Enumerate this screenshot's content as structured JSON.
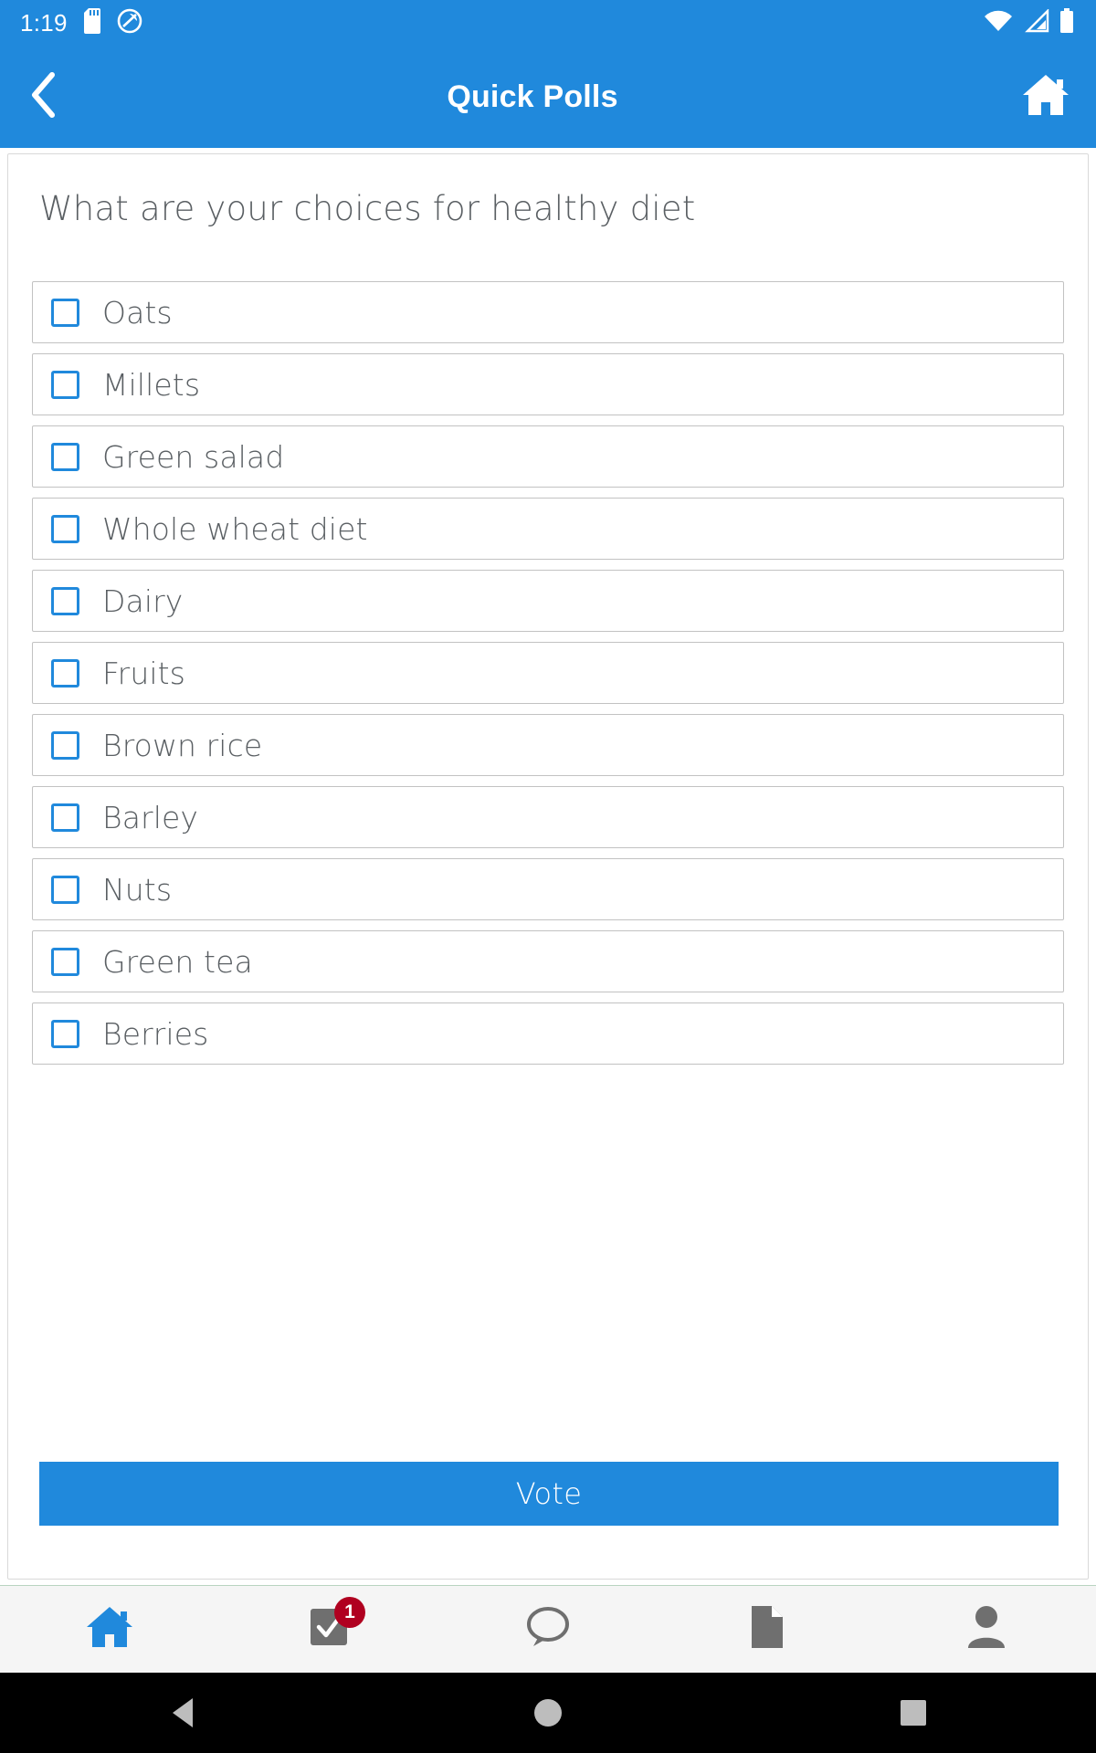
{
  "status_bar": {
    "time": "1:19",
    "icons": [
      "sd-card-icon",
      "do-not-disturb-icon",
      "wifi-icon",
      "cellular-signal-icon",
      "battery-icon"
    ]
  },
  "app_bar": {
    "title": "Quick Polls",
    "back_icon": "chevron-left-icon",
    "home_icon": "home-icon"
  },
  "poll": {
    "question": "What are your choices for healthy diet",
    "options": [
      {
        "label": "Oats",
        "checked": false
      },
      {
        "label": "Millets",
        "checked": false
      },
      {
        "label": "Green salad",
        "checked": false
      },
      {
        "label": "Whole wheat diet",
        "checked": false
      },
      {
        "label": "Dairy",
        "checked": false
      },
      {
        "label": "Fruits",
        "checked": false
      },
      {
        "label": "Brown rice",
        "checked": false
      },
      {
        "label": "Barley",
        "checked": false
      },
      {
        "label": "Nuts",
        "checked": false
      },
      {
        "label": "Green tea",
        "checked": false
      },
      {
        "label": "Berries",
        "checked": false
      }
    ],
    "vote_button_label": "Vote"
  },
  "bottom_nav": {
    "items": [
      {
        "icon": "home-icon",
        "active": true,
        "badge": null
      },
      {
        "icon": "task-checkbox-icon",
        "active": false,
        "badge": "1"
      },
      {
        "icon": "chat-bubble-icon",
        "active": false,
        "badge": null
      },
      {
        "icon": "document-icon",
        "active": false,
        "badge": null
      },
      {
        "icon": "person-icon",
        "active": false,
        "badge": null
      }
    ]
  },
  "android_nav": {
    "back_icon": "triangle-back-icon",
    "home_icon": "circle-home-icon",
    "recents_icon": "square-recents-icon"
  },
  "colors": {
    "primary": "#2089DC",
    "badge": "#b00020",
    "text": "#5a5f63",
    "border": "#c2c2c2"
  }
}
